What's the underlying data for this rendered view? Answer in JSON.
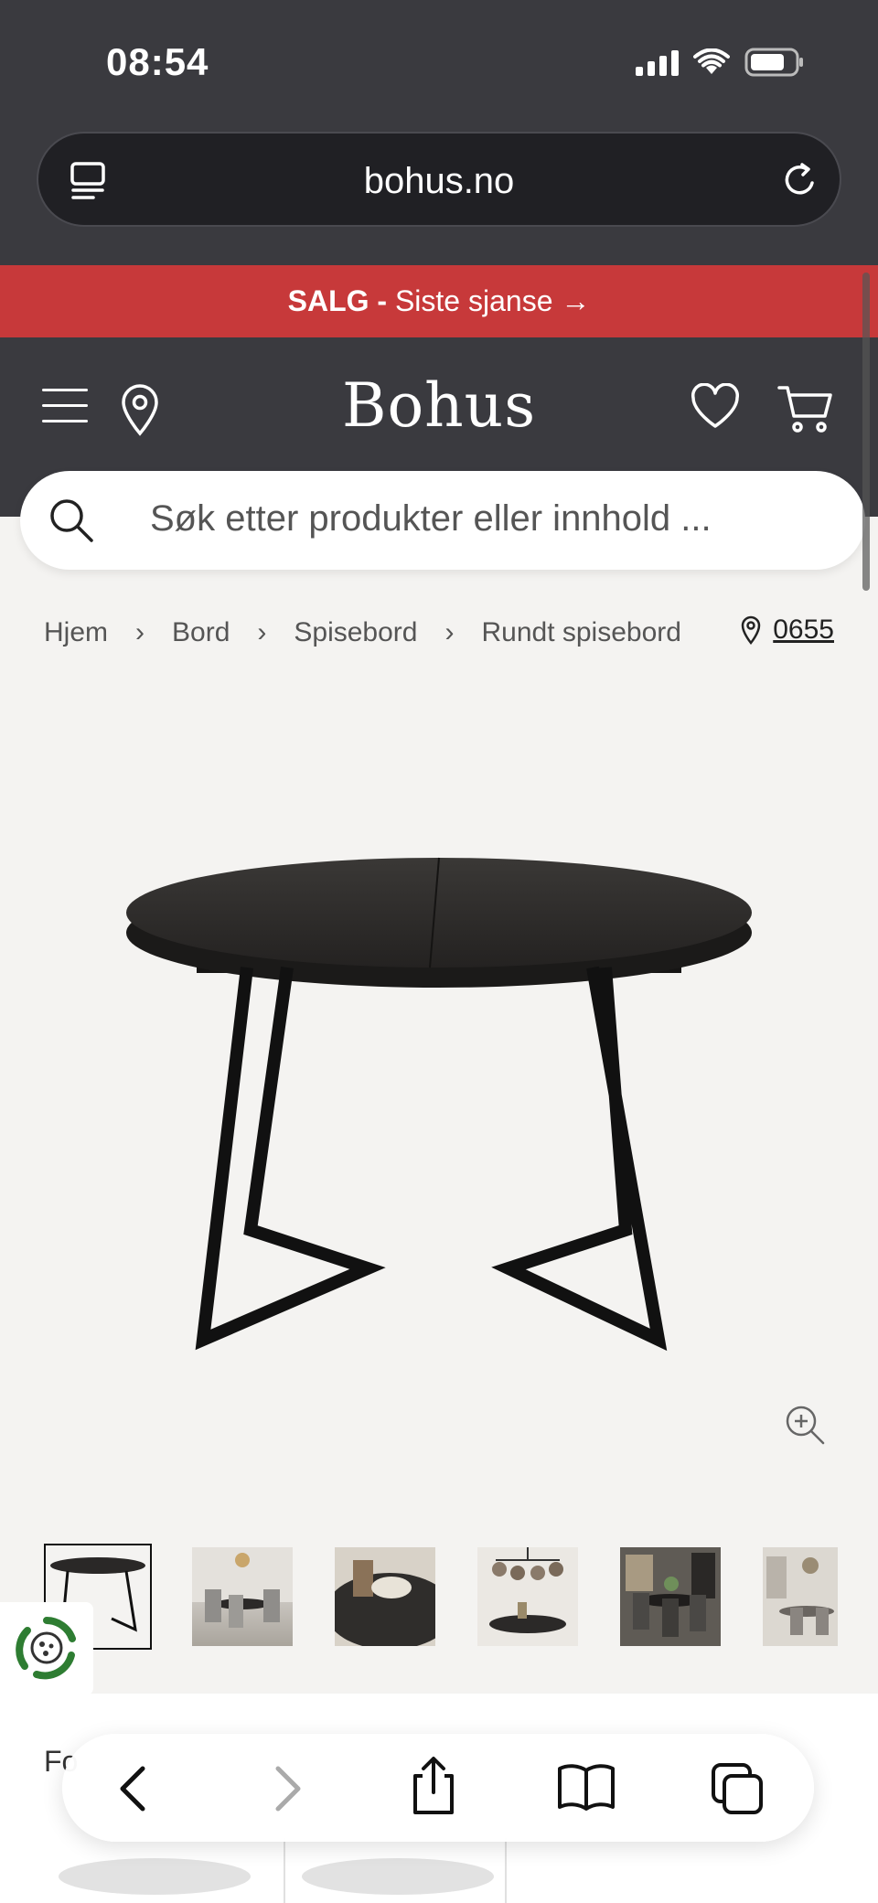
{
  "status_bar": {
    "time": "08:54"
  },
  "browser": {
    "url": "bohus.no"
  },
  "banner": {
    "bold": "SALG -",
    "text": "Siste sjanse",
    "arrow": "→"
  },
  "header": {
    "logo": "Bohus"
  },
  "search": {
    "placeholder": "Søk etter produkter eller innhold ..."
  },
  "breadcrumb": {
    "items": [
      "Hjem",
      "Bord",
      "Spisebord",
      "Rundt spisebord"
    ],
    "separator": "›"
  },
  "store": {
    "code": "0655"
  },
  "lower": {
    "heading_partial": "Fo"
  },
  "colors": {
    "dark": "#3a3a3f",
    "sale_red": "#c7393a",
    "background": "#f4f3f1"
  },
  "icons": {
    "menu": "menu-icon",
    "location": "location-pin-icon",
    "favorite": "heart-icon",
    "cart": "cart-icon",
    "search": "search-icon",
    "zoom": "zoom-in-icon",
    "back": "chevron-left-icon",
    "forward": "chevron-right-icon",
    "share": "share-icon",
    "bookmarks": "book-icon",
    "tabs": "tabs-icon",
    "eco": "recycle-icon"
  }
}
